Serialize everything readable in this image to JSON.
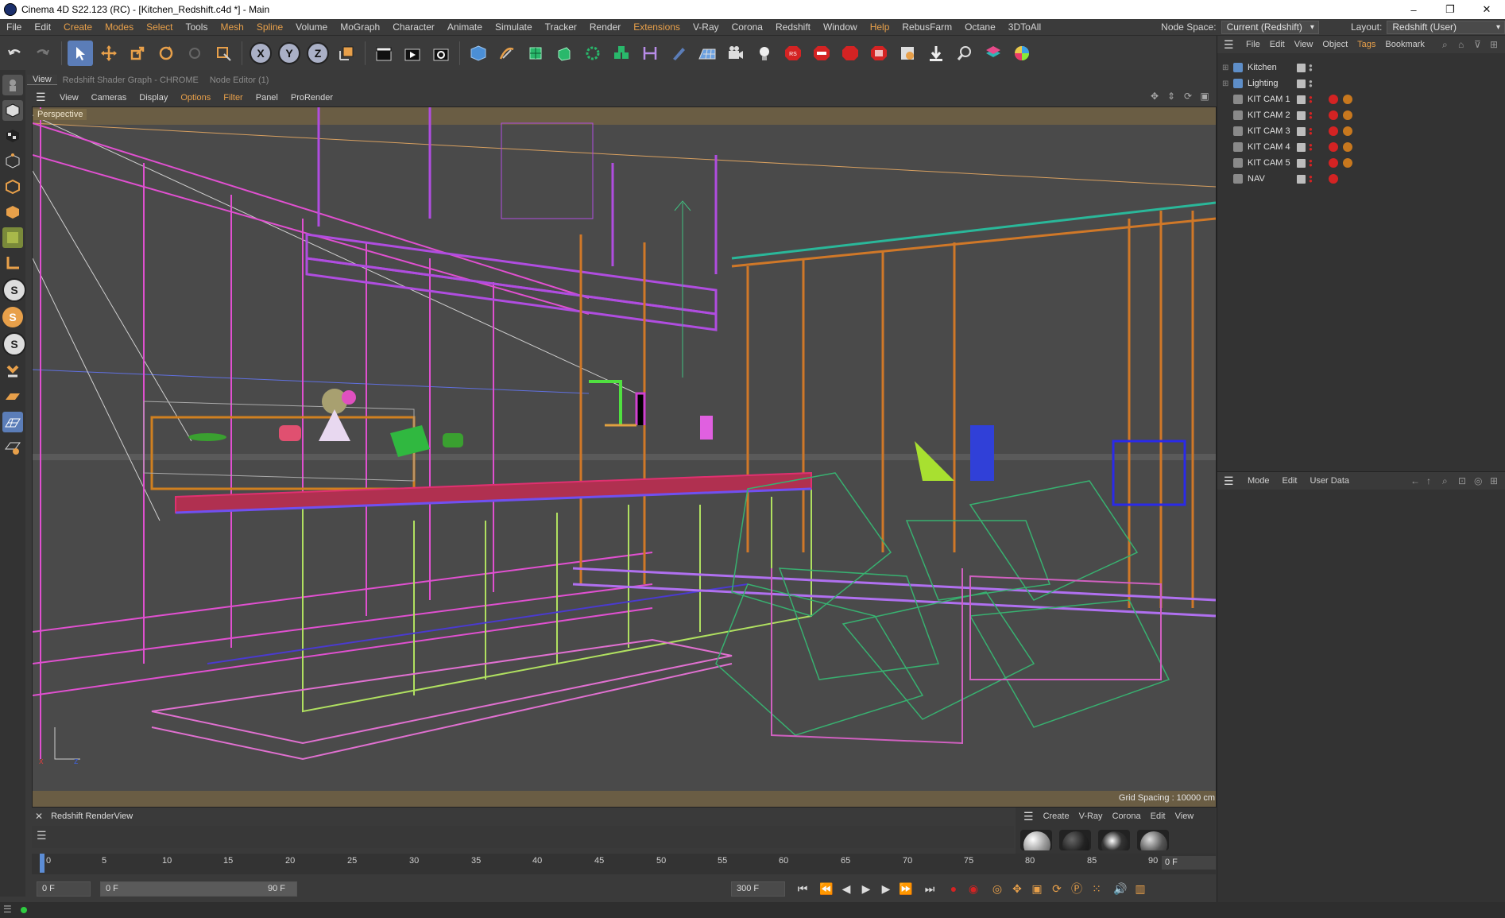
{
  "window": {
    "title": "Cinema 4D S22.123 (RC) - [Kitchen_Redshift.c4d *] - Main",
    "controls": [
      "–",
      "❐",
      "✕"
    ]
  },
  "menubar": {
    "items": [
      "File",
      "Edit",
      "Create",
      "Modes",
      "Select",
      "Tools",
      "Mesh",
      "Spline",
      "Volume",
      "MoGraph",
      "Character",
      "Animate",
      "Simulate",
      "Tracker",
      "Render",
      "Extensions",
      "V-Ray",
      "Corona",
      "Redshift",
      "Window",
      "Help",
      "RebusFarm",
      "Octane",
      "3DToAll"
    ],
    "highlighted": [
      "Create",
      "Modes",
      "Select",
      "Mesh",
      "Spline",
      "Extensions",
      "Help"
    ],
    "node_space_label": "Node Space:",
    "node_space_value": "Current (Redshift)",
    "layout_label": "Layout:",
    "layout_value": "Redshift (User)"
  },
  "toolbar": {
    "axis_x": "X",
    "axis_y": "Y",
    "axis_z": "Z"
  },
  "left_toolbar": {
    "s1": "S",
    "s2": "S",
    "s3": "S"
  },
  "viewport_tabs": [
    "View",
    "Redshift Shader Graph - CHROME",
    "Node Editor (1)"
  ],
  "viewport_menu": [
    "View",
    "Cameras",
    "Display",
    "Options",
    "Filter",
    "Panel",
    "ProRender"
  ],
  "viewport": {
    "camera_label": "Perspective",
    "grid_spacing": "Grid Spacing : 10000 cm",
    "axis_x": "x",
    "axis_z": "z"
  },
  "object_manager": {
    "menu": [
      "File",
      "Edit",
      "View",
      "Object",
      "Tags",
      "Bookmark"
    ],
    "highlighted": [
      "Tags"
    ],
    "objects": [
      {
        "name": "Kitchen",
        "type": "layer",
        "tags": 0
      },
      {
        "name": "Lighting",
        "type": "layer",
        "tags": 0
      },
      {
        "name": "KIT CAM 1",
        "type": "camera",
        "tags": 2
      },
      {
        "name": "KIT CAM 2",
        "type": "camera",
        "tags": 2
      },
      {
        "name": "KIT CAM 3",
        "type": "camera",
        "tags": 2
      },
      {
        "name": "KIT CAM 4",
        "type": "camera",
        "tags": 2
      },
      {
        "name": "KIT CAM 5",
        "type": "camera",
        "tags": 2
      },
      {
        "name": "NAV",
        "type": "camera",
        "tags": 1
      }
    ]
  },
  "attribute_manager": {
    "menu": [
      "Mode",
      "Edit",
      "User Data"
    ]
  },
  "render_view": {
    "title": "Redshift RenderView",
    "close": "✕"
  },
  "material_manager": {
    "menu": [
      "Create",
      "V-Ray",
      "Corona",
      "Edit",
      "View"
    ]
  },
  "timeline": {
    "ticks": [
      "0",
      "5",
      "10",
      "15",
      "20",
      "25",
      "30",
      "35",
      "40",
      "45",
      "50",
      "55",
      "60",
      "65",
      "70",
      "75",
      "80",
      "85",
      "90"
    ],
    "current_frame": "0 F"
  },
  "transport": {
    "start_frame": "0 F",
    "range_start": "0 F",
    "range_end": "90 F",
    "end_frame": "300 F"
  },
  "colors": {
    "accent": "#e8a04a",
    "timeline_cursor": "#5c8dd6",
    "tag_red": "#d42323",
    "tag_orange": "#c8781e"
  }
}
